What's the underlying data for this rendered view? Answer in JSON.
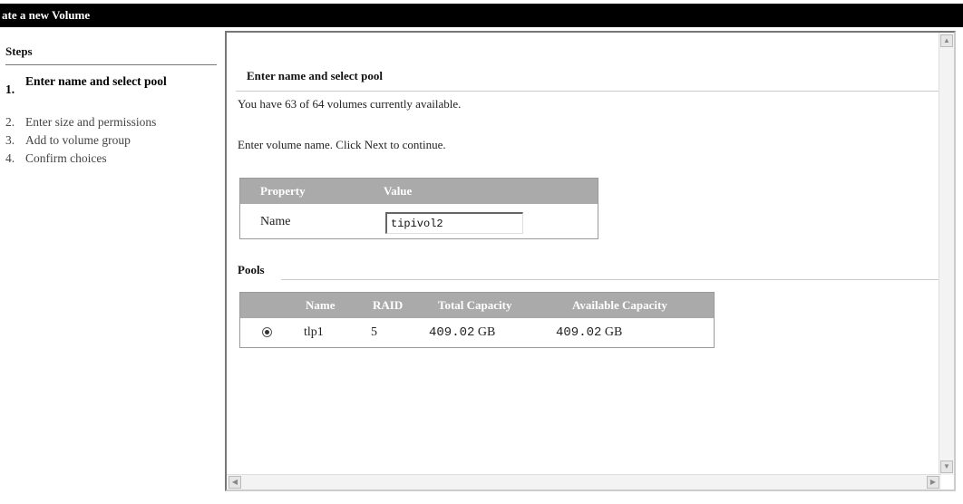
{
  "window": {
    "title": "ate a new Volume"
  },
  "steps": {
    "title": "Steps",
    "items": [
      {
        "num": "1.",
        "label": "Enter name and select pool"
      },
      {
        "num": "2.",
        "label": "Enter size and permissions"
      },
      {
        "num": "3.",
        "label": "Add to volume group"
      },
      {
        "num": "4.",
        "label": "Confirm choices"
      }
    ]
  },
  "main": {
    "section_title": "Enter name and select pool",
    "availability_text": "You have 63 of 64 volumes currently available.",
    "instruction_text": "Enter volume name. Click Next to continue.",
    "property_table": {
      "headers": {
        "property": "Property",
        "value": "Value"
      },
      "rows": [
        {
          "property": "Name",
          "value": "tipivol2"
        }
      ]
    },
    "pools": {
      "title": "Pools",
      "headers": {
        "name": "Name",
        "raid": "RAID",
        "total": "Total Capacity",
        "available": "Available Capacity"
      },
      "rows": [
        {
          "name": "tlp1",
          "raid": "5",
          "total_value": "409.02",
          "total_unit": "GB",
          "available_value": "409.02",
          "available_unit": "GB",
          "selected": true
        }
      ]
    }
  }
}
